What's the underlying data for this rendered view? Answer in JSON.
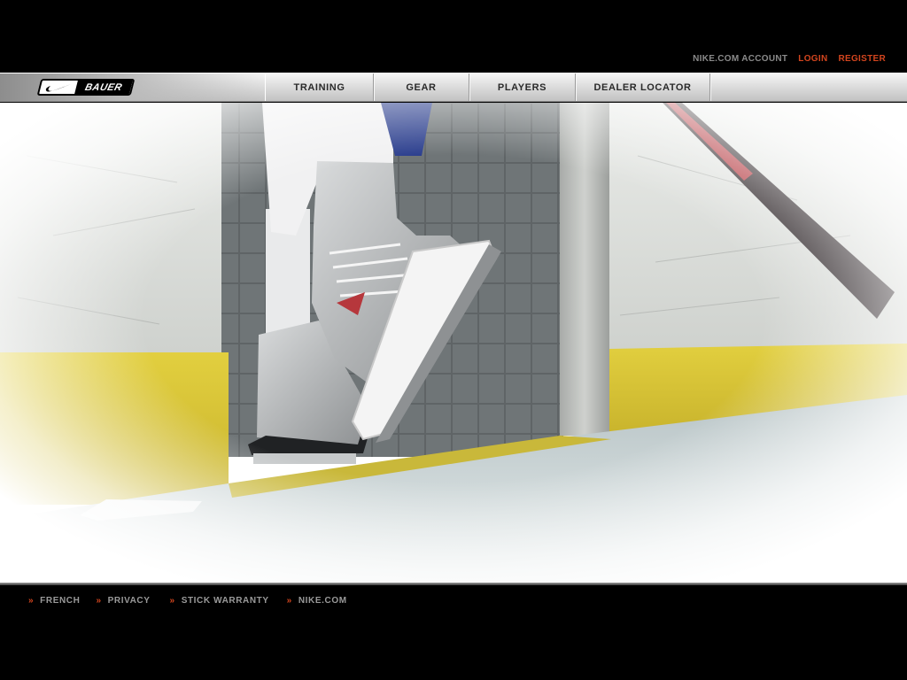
{
  "account": {
    "nike_account": "NIKE.COM ACCOUNT",
    "login": "LOGIN",
    "register": "REGISTER"
  },
  "brand": {
    "logo_text": "BAUER",
    "logo_icon": "swoosh-icon"
  },
  "nav": {
    "items": [
      {
        "label": "TRAINING"
      },
      {
        "label": "GEAR"
      },
      {
        "label": "PLAYERS"
      },
      {
        "label": "DEALER LOCATOR"
      }
    ]
  },
  "footer": {
    "links": [
      {
        "label": "FRENCH"
      },
      {
        "label": "PRIVACY"
      },
      {
        "label": "STICK WARRANTY"
      },
      {
        "label": "NIKE.COM"
      }
    ],
    "chevron_glyph": "»"
  },
  "colors": {
    "accent": "#d3451e",
    "muted_link": "#8a8a8a",
    "board_yellow": "#d9c437",
    "background": "#000000"
  }
}
